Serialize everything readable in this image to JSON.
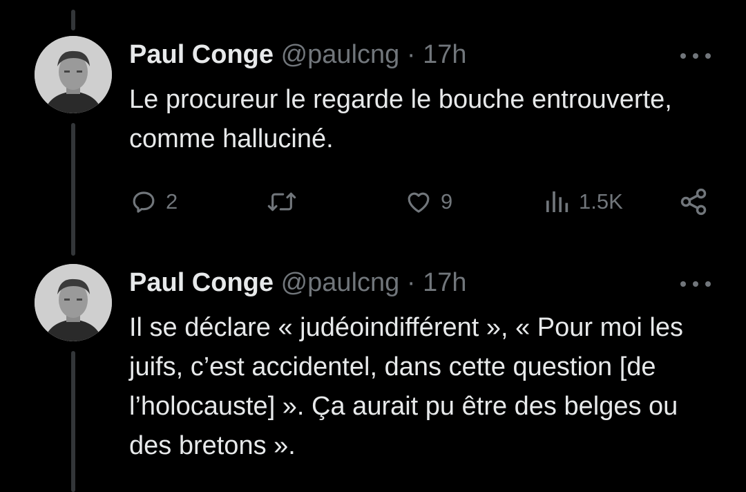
{
  "tweets": [
    {
      "name": "Paul Conge",
      "handle": "@paulcng",
      "separator": "·",
      "time": "17h",
      "text": "Le procureur le regarde le bouche entrouverte, comme halluciné.",
      "actions": {
        "replies": "2",
        "retweets": "",
        "likes": "9",
        "views": "1.5K"
      }
    },
    {
      "name": "Paul Conge",
      "handle": "@paulcng",
      "separator": "·",
      "time": "17h",
      "text": "Il se déclare « judéoindifférent », « Pour moi les juifs, c’est accidentel, dans cette question [de l’holocauste] ». Ça aurait pu être des belges ou des bretons »."
    }
  ],
  "icons": {
    "reply": "reply-icon",
    "retweet": "retweet-icon",
    "like": "heart-icon",
    "views": "views-chart-icon",
    "share": "share-icon",
    "more": "more-options-icon"
  },
  "colors": {
    "background": "#000000",
    "text": "#e7e9ea",
    "muted": "#71767b",
    "thread_line": "#333639"
  }
}
